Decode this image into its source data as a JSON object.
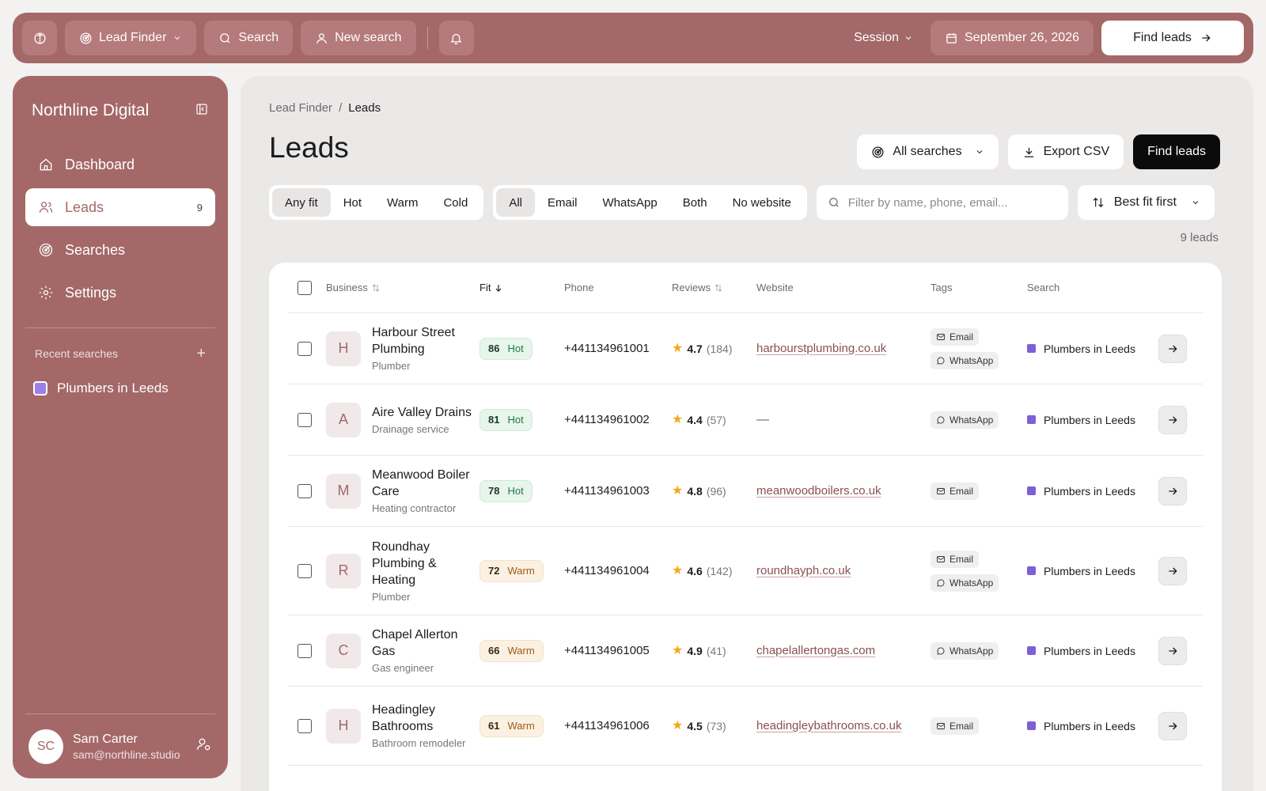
{
  "topbar": {
    "app_menu_label": "Lead Finder",
    "search_label": "Search",
    "new_search_label": "New search",
    "session_label": "Session",
    "date_label": "September 26, 2026",
    "find_leads_label": "Find leads"
  },
  "sidebar": {
    "workspace": "Northline Digital",
    "items": [
      {
        "label": "Dashboard",
        "icon": "home-icon"
      },
      {
        "label": "Leads",
        "icon": "users-icon",
        "count": "9",
        "active": true
      },
      {
        "label": "Searches",
        "icon": "radar-icon"
      },
      {
        "label": "Settings",
        "icon": "gear-icon"
      }
    ],
    "recent_heading": "Recent searches",
    "recent": [
      {
        "label": "Plumbers in Leeds",
        "color": "#9c80e6"
      }
    ],
    "user": {
      "initials": "SC",
      "name": "Sam Carter",
      "email": "sam@northline.studio"
    }
  },
  "main": {
    "breadcrumb": {
      "parent": "Lead Finder",
      "sep": "/",
      "current": "Leads"
    },
    "title": "Leads",
    "actions": {
      "all_searches": "All searches",
      "export": "Export CSV",
      "find": "Find leads"
    },
    "fit_filters": [
      "Any fit",
      "Hot",
      "Warm",
      "Cold"
    ],
    "fit_selected": "Any fit",
    "channel_filters": [
      "All",
      "Email",
      "WhatsApp",
      "Both",
      "No website"
    ],
    "channel_selected": "All",
    "filter_placeholder": "Filter by name, phone, email...",
    "sort_label": "Best fit first",
    "lead_count": "9 leads"
  },
  "table": {
    "headers": {
      "business": "Business",
      "fit": "Fit",
      "phone": "Phone",
      "reviews": "Reviews",
      "website": "Website",
      "tags": "Tags",
      "search": "Search"
    },
    "rows": [
      {
        "initial": "H",
        "name": "Harbour Street Plumbing",
        "category": "Plumber",
        "fit": "86",
        "fit_label": "Hot",
        "phone": "+441134961001",
        "rating": "4.7",
        "reviews": "(184)",
        "website": "harbourstplumbing.co.uk",
        "tags": [
          "Email",
          "WhatsApp"
        ],
        "search": "Plumbers in Leeds"
      },
      {
        "initial": "A",
        "name": "Aire Valley Drains",
        "category": "Drainage service",
        "fit": "81",
        "fit_label": "Hot",
        "phone": "+441134961002",
        "rating": "4.4",
        "reviews": "(57)",
        "website": "—",
        "tags": [
          "WhatsApp"
        ],
        "search": "Plumbers in Leeds"
      },
      {
        "initial": "M",
        "name": "Meanwood Boiler Care",
        "category": "Heating contractor",
        "fit": "78",
        "fit_label": "Hot",
        "phone": "+441134961003",
        "rating": "4.8",
        "reviews": "(96)",
        "website": "meanwoodboilers.co.uk",
        "tags": [
          "Email"
        ],
        "search": "Plumbers in Leeds"
      },
      {
        "initial": "R",
        "name": "Roundhay Plumbing & Heating",
        "category": "Plumber",
        "fit": "72",
        "fit_label": "Warm",
        "phone": "+441134961004",
        "rating": "4.6",
        "reviews": "(142)",
        "website": "roundhayph.co.uk",
        "tags": [
          "Email",
          "WhatsApp"
        ],
        "search": "Plumbers in Leeds"
      },
      {
        "initial": "C",
        "name": "Chapel Allerton Gas",
        "category": "Gas engineer",
        "fit": "66",
        "fit_label": "Warm",
        "phone": "+441134961005",
        "rating": "4.9",
        "reviews": "(41)",
        "website": "chapelallertongas.com",
        "tags": [
          "WhatsApp"
        ],
        "search": "Plumbers in Leeds"
      },
      {
        "initial": "H",
        "name": "Headingley Bathrooms",
        "category": "Bathroom remodeler",
        "fit": "61",
        "fit_label": "Warm",
        "phone": "+441134961006",
        "rating": "4.5",
        "reviews": "(73)",
        "website": "headingleybathrooms.co.uk",
        "tags": [
          "Email"
        ],
        "search": "Plumbers in Leeds"
      }
    ]
  }
}
